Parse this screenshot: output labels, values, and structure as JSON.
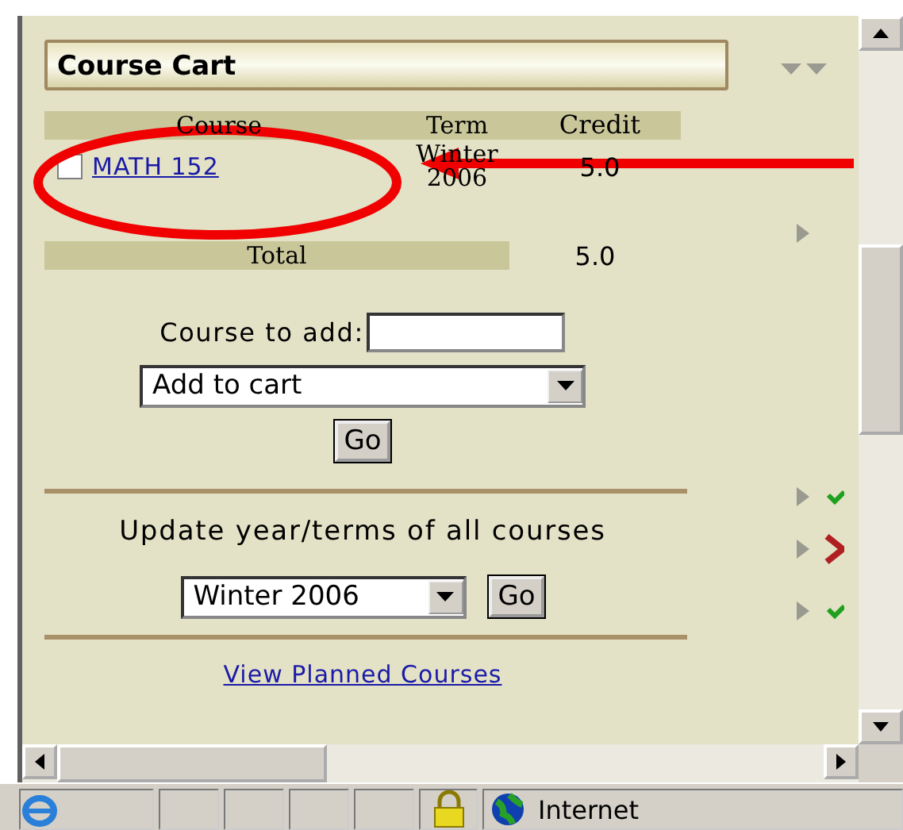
{
  "panel": {
    "title": "Course Cart"
  },
  "table": {
    "columns": [
      "Course",
      "Term",
      "Credit"
    ],
    "rows": [
      {
        "checked": false,
        "course": "MATH 152",
        "term": "Winter 2006",
        "credit": "5.0"
      }
    ],
    "total_label": "Total",
    "total_value": "5.0"
  },
  "add_form": {
    "label": "Course to add:",
    "value_select": "Add to cart",
    "button": "Go"
  },
  "update_form": {
    "label": "Update year/terms of all courses",
    "term_select": "Winter 2006",
    "button": "Go"
  },
  "link": "View Planned Courses",
  "side_marks": [
    {
      "kind": "arrow"
    },
    {
      "kind": "check"
    },
    {
      "kind": "cross"
    },
    {
      "kind": "check"
    }
  ],
  "status_bar": {
    "zone": "Internet"
  }
}
